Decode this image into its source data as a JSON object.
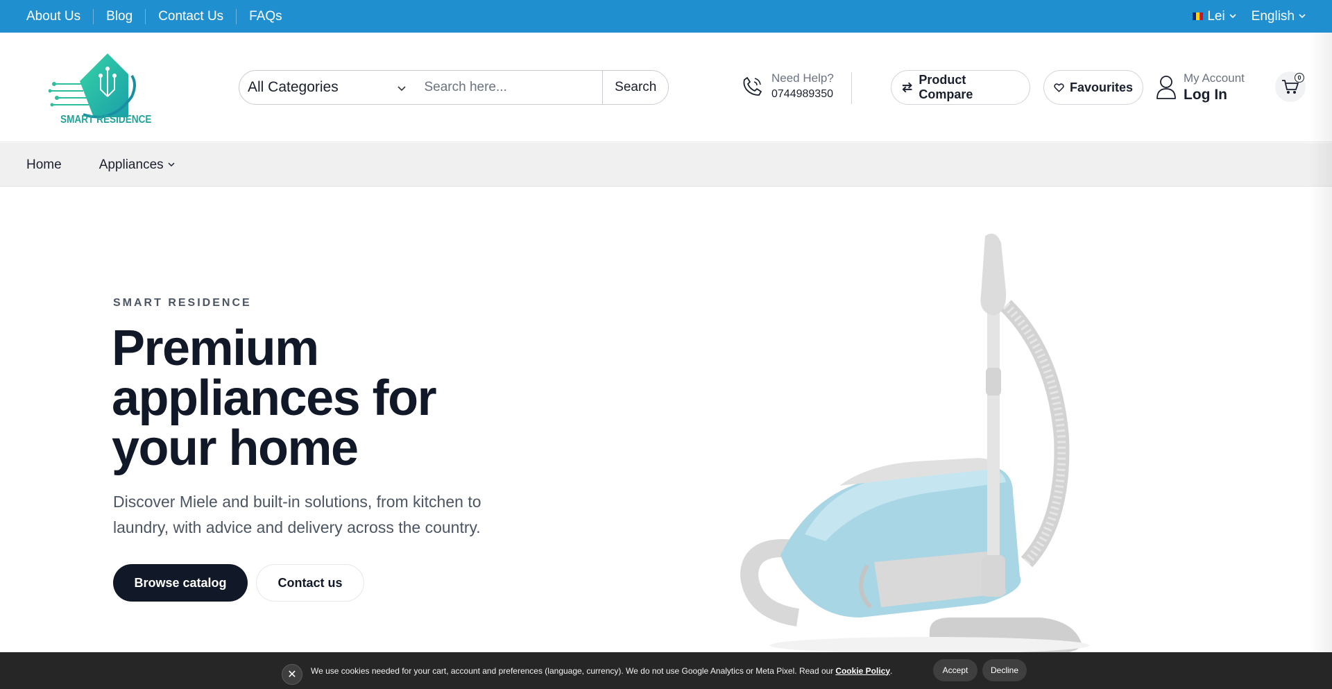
{
  "topbar": {
    "links": [
      "About Us",
      "Blog",
      "Contact Us",
      "FAQs"
    ],
    "currency": "Lei",
    "language": "English",
    "bg_color": "#1f8fd0"
  },
  "header": {
    "logo_text": "SMART RESIDENCE",
    "search": {
      "category": "All Categories",
      "placeholder": "Search here...",
      "button": "Search"
    },
    "help": {
      "label": "Need Help?",
      "phone": "0744989350"
    },
    "compare_label": "Product Compare",
    "favourites_label": "Favourites",
    "account": {
      "label": "My Account",
      "action": "Log In"
    },
    "cart_count": "0"
  },
  "nav": {
    "items": [
      "Home",
      "Appliances"
    ]
  },
  "hero": {
    "kicker": "SMART RESIDENCE",
    "title_lines": [
      "Premium",
      "appliances for",
      "your home"
    ],
    "subtitle": "Discover Miele and built-in solutions, from kitchen to laundry, with advice and delivery across the country.",
    "primary_button": "Browse catalog",
    "secondary_button": "Contact us"
  },
  "cookie": {
    "text": "We use cookies needed for your cart, account and preferences (language, currency). We do not use Google Analytics or Meta Pixel. Read our",
    "link": "Cookie Policy",
    "accept": "Accept",
    "decline": "Decline",
    "close_icon": "close-icon"
  }
}
